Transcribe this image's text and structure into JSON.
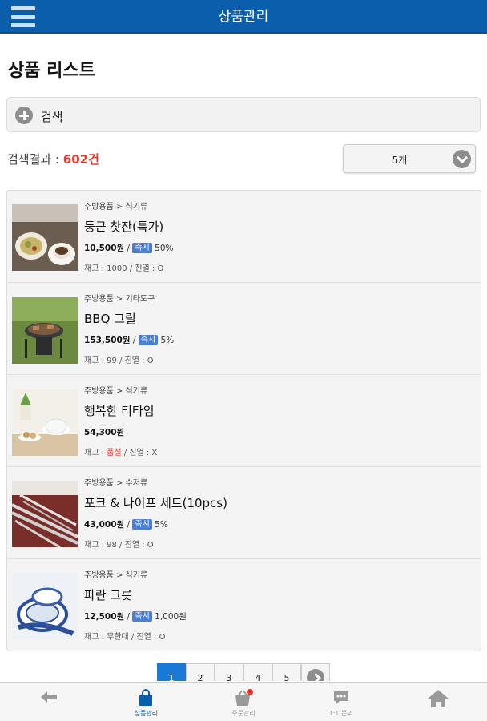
{
  "header": {
    "title": "상품관리"
  },
  "page_title": "상품 리스트",
  "search": {
    "label": "검색"
  },
  "result": {
    "prefix": "검색결과 : ",
    "count": "602건"
  },
  "page_size": {
    "selected": "5개"
  },
  "products": [
    {
      "category": "주방용품 > 식기류",
      "name": "둥근 찻잔(특가)",
      "price": "10,500원",
      "sep": " / ",
      "badge": "즉시",
      "discount": "50%",
      "stock_label": "재고 : ",
      "stock": "1000",
      "display": " / 진열 : O"
    },
    {
      "category": "주방용품 > 기타도구",
      "name": "BBQ 그릴",
      "price": "153,500원",
      "sep": " / ",
      "badge": "즉시",
      "discount": "5%",
      "stock_label": "재고 : ",
      "stock": "99",
      "display": " / 진열 : O"
    },
    {
      "category": "주방용품 > 식기류",
      "name": "행복한 티타임",
      "price": "54,300원",
      "stock_label": "재고 : ",
      "stock": "품절",
      "display": " / 진열 : X"
    },
    {
      "category": "주방용품 > 수저류",
      "name": "포크 & 나이프 세트(10pcs)",
      "price": "43,000원",
      "sep": " / ",
      "badge": "즉시",
      "discount": "5%",
      "stock_label": "재고 : ",
      "stock": "98",
      "display": " / 진열 : O"
    },
    {
      "category": "주방용품 > 식기류",
      "name": "파란 그릇",
      "price": "12,500원",
      "sep": " / ",
      "badge": "즉시",
      "discount": "1,000원",
      "stock_label": "재고 : ",
      "stock": "무한대",
      "display": " / 진열 : O"
    }
  ],
  "pagination": {
    "pages": [
      "1",
      "2",
      "3",
      "4",
      "5"
    ],
    "current": "1"
  },
  "tabbar": [
    {
      "icon": "back-arrow-icon",
      "label": ""
    },
    {
      "icon": "shopping-bag-icon",
      "label": "상품관리"
    },
    {
      "icon": "basket-icon",
      "label": "주문관리"
    },
    {
      "icon": "chat-bubble-icon",
      "label": "1:1 문의"
    },
    {
      "icon": "home-icon",
      "label": ""
    }
  ],
  "colors": {
    "header_bg": "#0a5eab",
    "accent_red": "#e53a2f",
    "badge_blue": "#4b7fd1",
    "active_page": "#1a78d6"
  }
}
